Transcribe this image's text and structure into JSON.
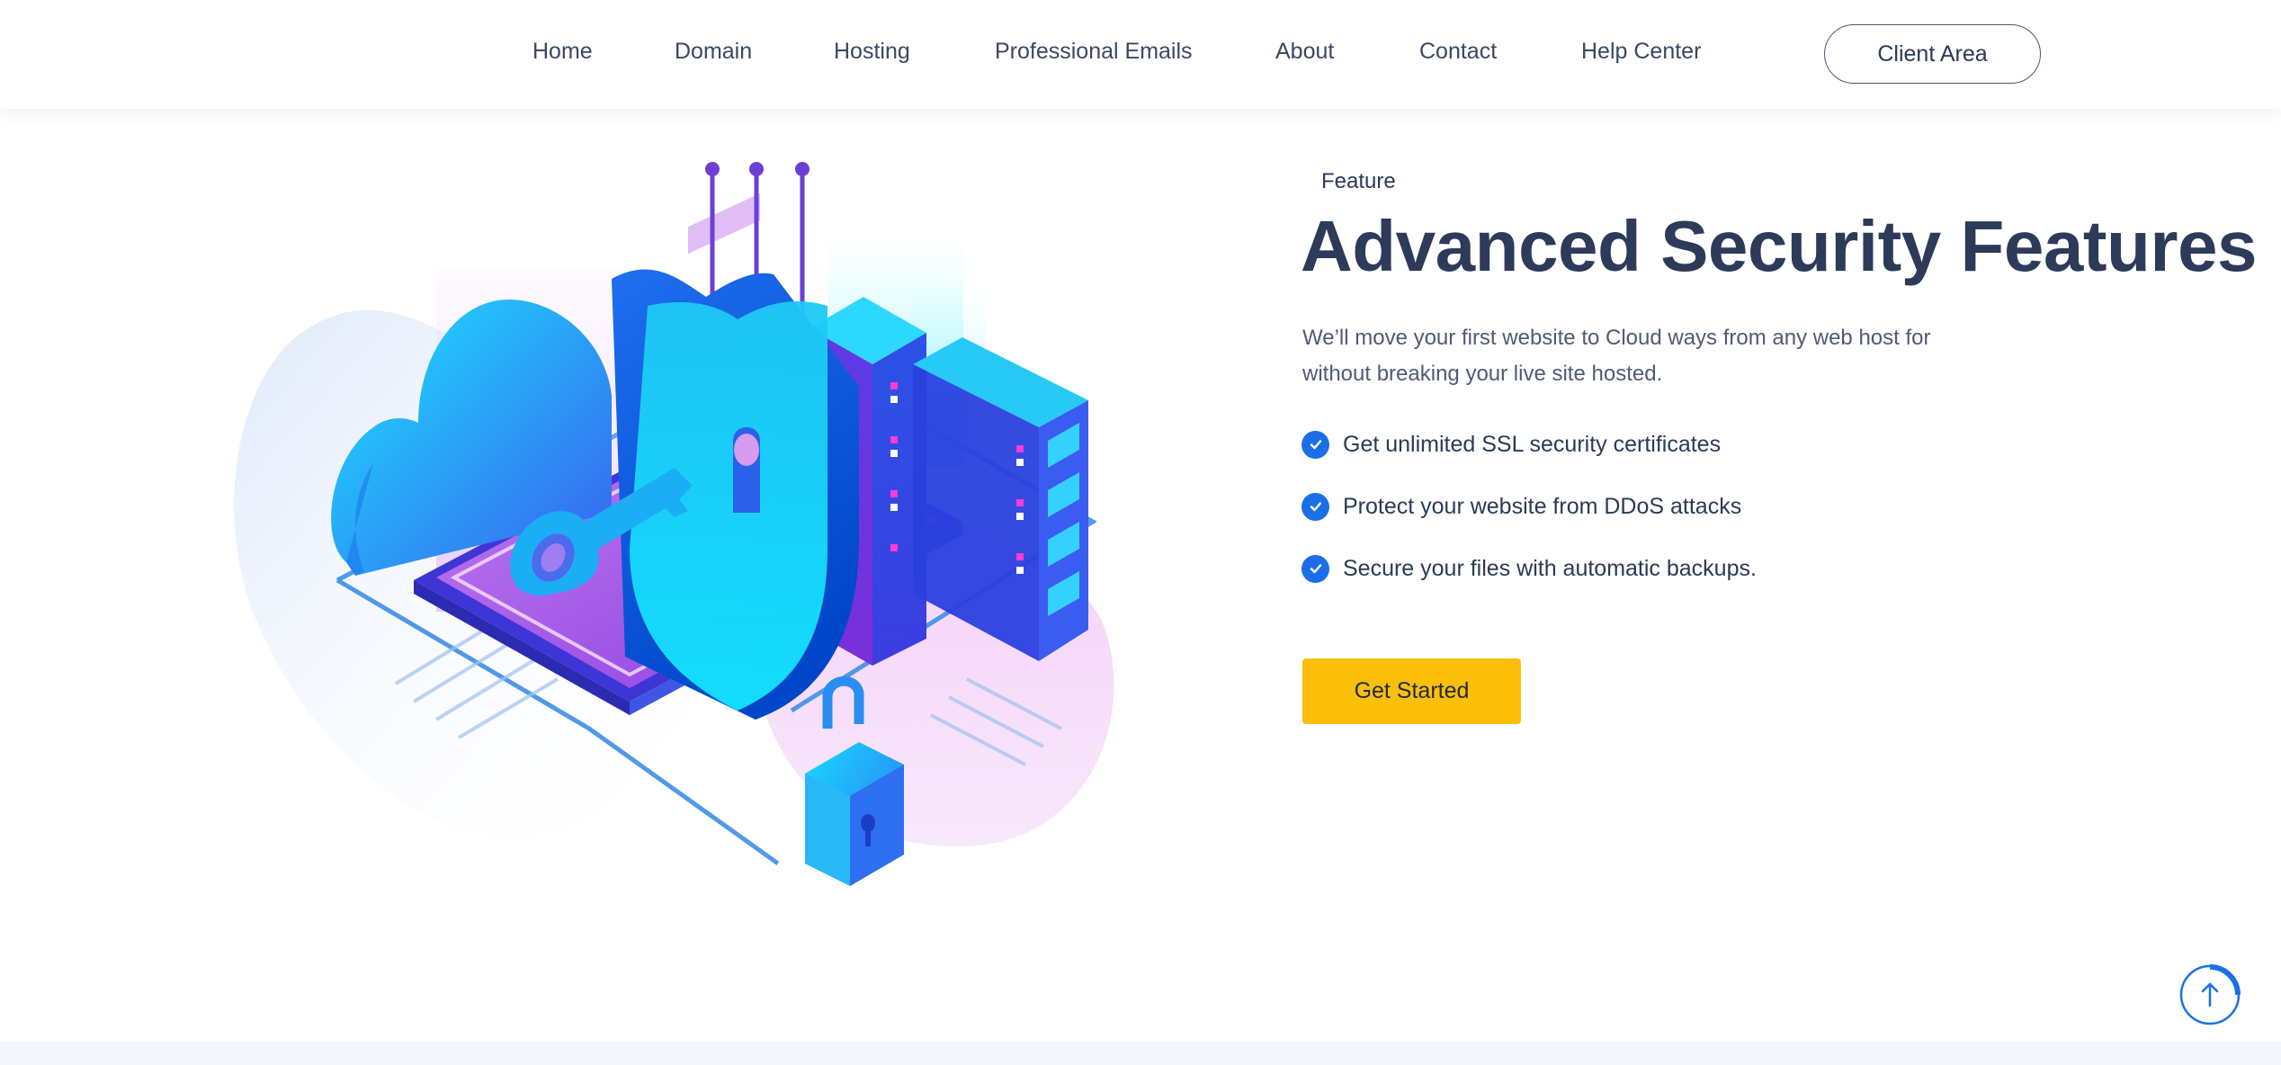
{
  "nav": {
    "items": [
      {
        "label": "Home"
      },
      {
        "label": "Domain"
      },
      {
        "label": "Hosting"
      },
      {
        "label": "Professional Emails"
      },
      {
        "label": "About"
      },
      {
        "label": "Contact"
      },
      {
        "label": "Help Center"
      }
    ],
    "client_area_label": "Client Area"
  },
  "section": {
    "eyebrow": "Feature",
    "title": "Advanced Security Features",
    "description": "We’ll move your first website to Cloud ways from any web host for without breaking your live site hosted.",
    "features": [
      {
        "text": "Get unlimited SSL security certificates"
      },
      {
        "text": "Protect your website from DDoS attacks"
      },
      {
        "text": "Secure your files with automatic backups."
      }
    ],
    "cta_label": "Get Started"
  },
  "illustration": {
    "icons": [
      "cloud-icon",
      "shield-icon",
      "key-icon",
      "server-rack-icon",
      "padlock-icon"
    ]
  },
  "scroll_top": {
    "icon": "arrow-up-icon",
    "progress": 0.25
  },
  "colors": {
    "accent_blue": "#1a6fe8",
    "cta_yellow": "#fbbf0a",
    "heading": "#2d3a5a",
    "purple": "#6a2fd6",
    "cyan": "#19d4f5"
  }
}
